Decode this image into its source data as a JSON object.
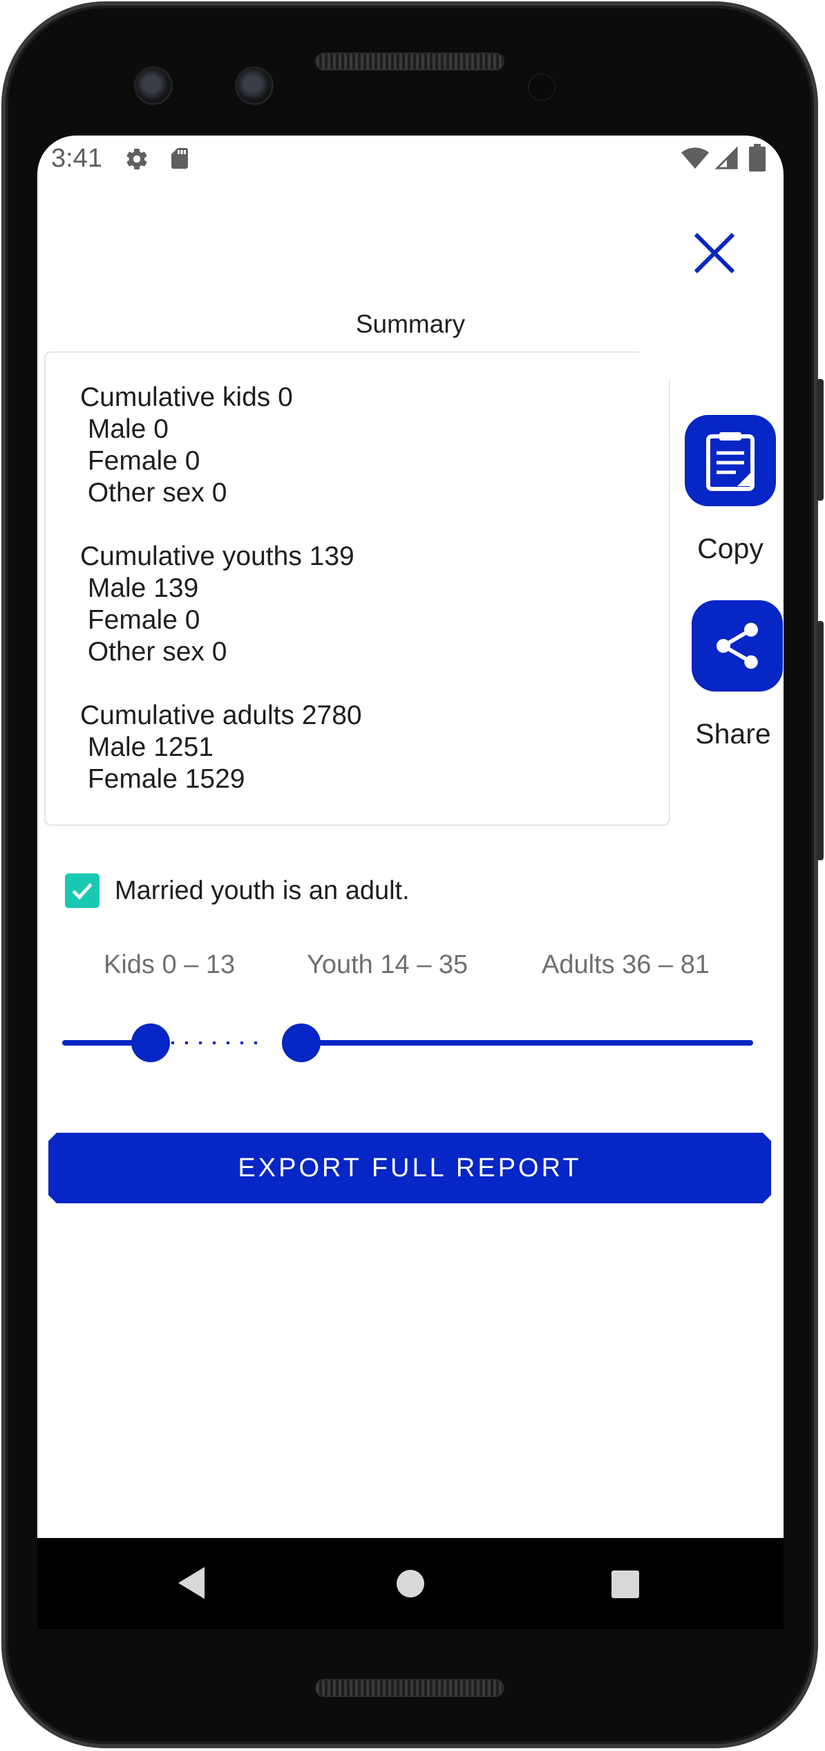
{
  "status_bar": {
    "time": "3:41",
    "icons": [
      "settings-icon",
      "sd-card-icon",
      "wifi-icon",
      "signal-icon",
      "battery-icon"
    ]
  },
  "header": {
    "close_icon": "close-icon",
    "title": "Summary"
  },
  "summary": {
    "text": "Cumulative kids 0\n Male 0\n Female 0\n Other sex 0\n\nCumulative youths 139\n Male 139\n Female 0\n Other sex 0\n\nCumulative adults 2780\n Male 1251\n Female 1529"
  },
  "actions": {
    "copy_label": "Copy",
    "copy_icon": "clipboard-icon",
    "share_label": "Share",
    "share_icon": "share-icon"
  },
  "options": {
    "married_youth_label": "Married youth is an adult.",
    "married_youth_checked": true
  },
  "age_ranges": {
    "kids_label": "Kids 0 – 13",
    "youth_label": "Youth 14 – 35",
    "adults_label": "Adults 36 – 81",
    "slider_thumbs": [
      13,
      35
    ],
    "slider_max": 81
  },
  "export_button_label": "EXPORT FULL REPORT",
  "nav": {
    "back_icon": "back-icon",
    "home_icon": "home-icon",
    "recents_icon": "recents-icon"
  },
  "colors": {
    "accent": "#0626c5",
    "checkbox": "#19c9b3",
    "label_gray": "#6f6f6f"
  }
}
